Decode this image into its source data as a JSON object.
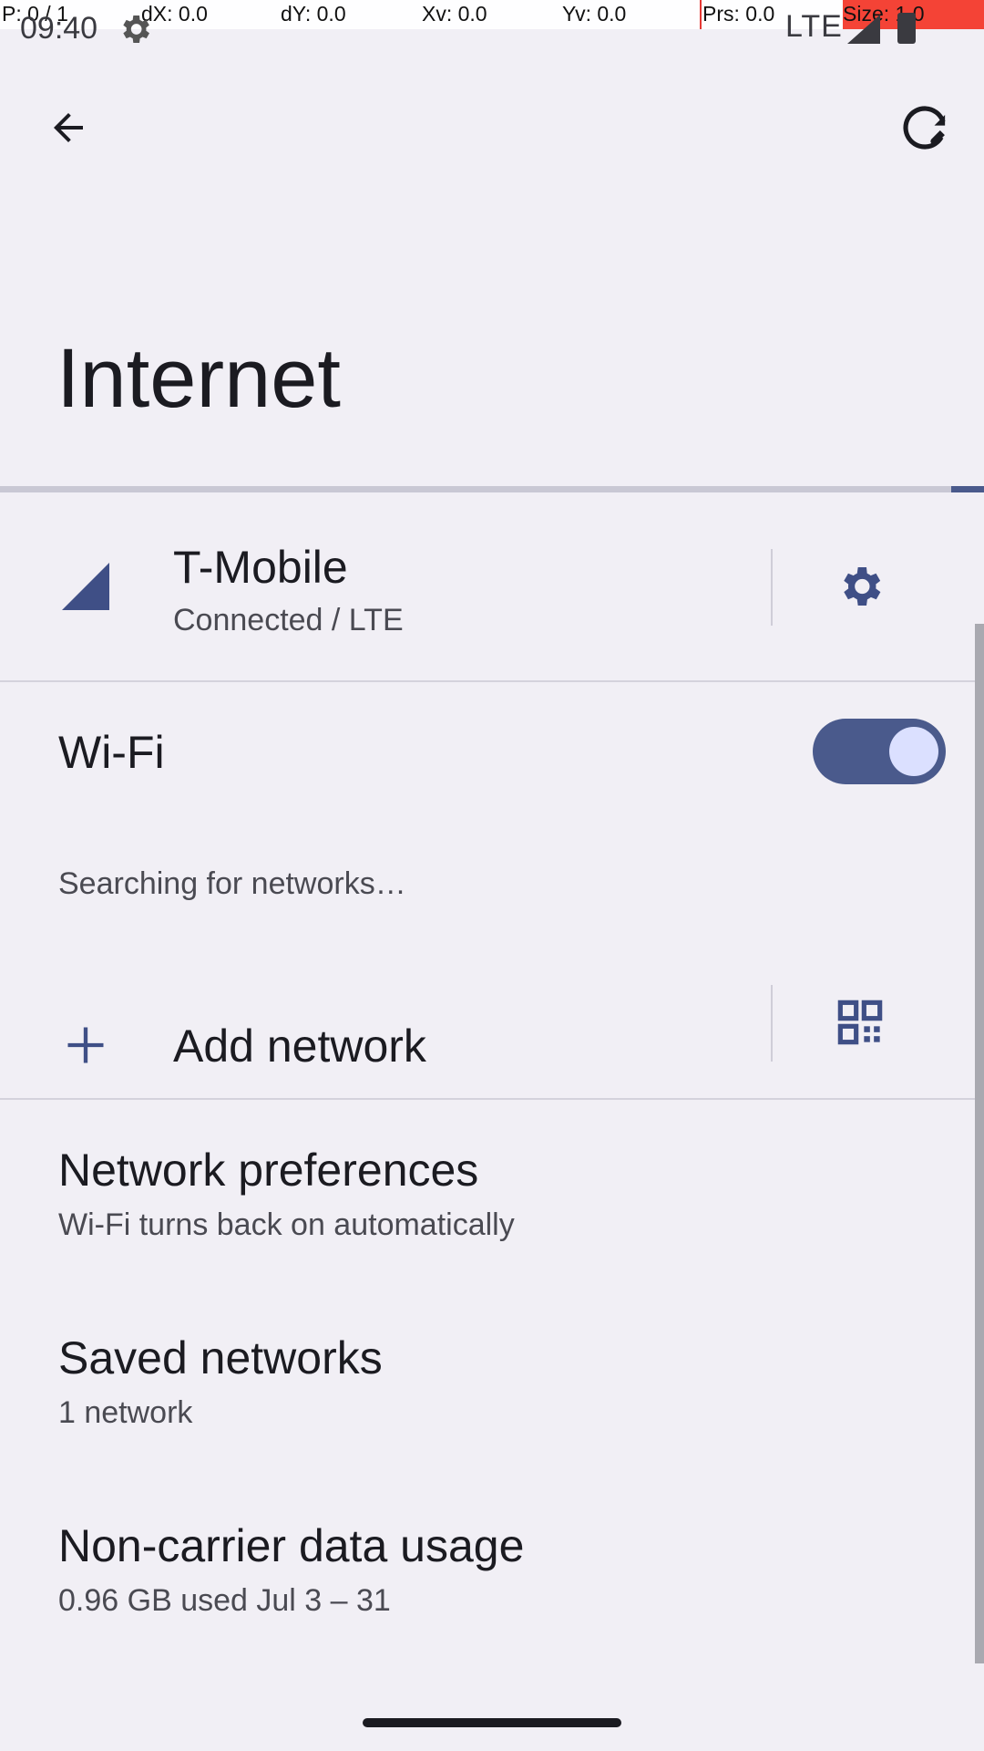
{
  "debug": {
    "pointer": "P: 0 / 1",
    "dx": "dX: 0.0",
    "dy": "dY: 0.0",
    "xv": "Xv: 0.0",
    "yv": "Yv: 0.0",
    "prs": "Prs: 0.0",
    "size": "Size: 1.0"
  },
  "status_bar": {
    "time": "09:40",
    "network": "LTE",
    "icons": [
      "settings-gear-icon",
      "signal-icon",
      "battery-icon"
    ]
  },
  "app_bar": {
    "back_icon": "arrow-back-icon",
    "refresh_icon": "refresh-wrench-icon"
  },
  "title": "Internet",
  "progress": {
    "fraction": 0.033
  },
  "carrier": {
    "name": "T-Mobile",
    "status": "Connected / LTE",
    "icon": "cell-signal-icon",
    "settings_icon": "gear-icon"
  },
  "wifi": {
    "label": "Wi-Fi",
    "enabled": true
  },
  "searching_text": "Searching for networks…",
  "add_network": {
    "label": "Add network",
    "icon": "plus-icon",
    "qr_icon": "qr-code-scan-icon"
  },
  "list": [
    {
      "title": "Network preferences",
      "summary": "Wi-Fi turns back on automatically"
    },
    {
      "title": "Saved networks",
      "summary": "1 network"
    },
    {
      "title": "Non-carrier data usage",
      "summary": "0.96 GB used Jul 3 – 31"
    }
  ],
  "colors": {
    "accent": "#4a5a8c",
    "background": "#f1eff5",
    "toggle_thumb": "#dbe0ff"
  }
}
